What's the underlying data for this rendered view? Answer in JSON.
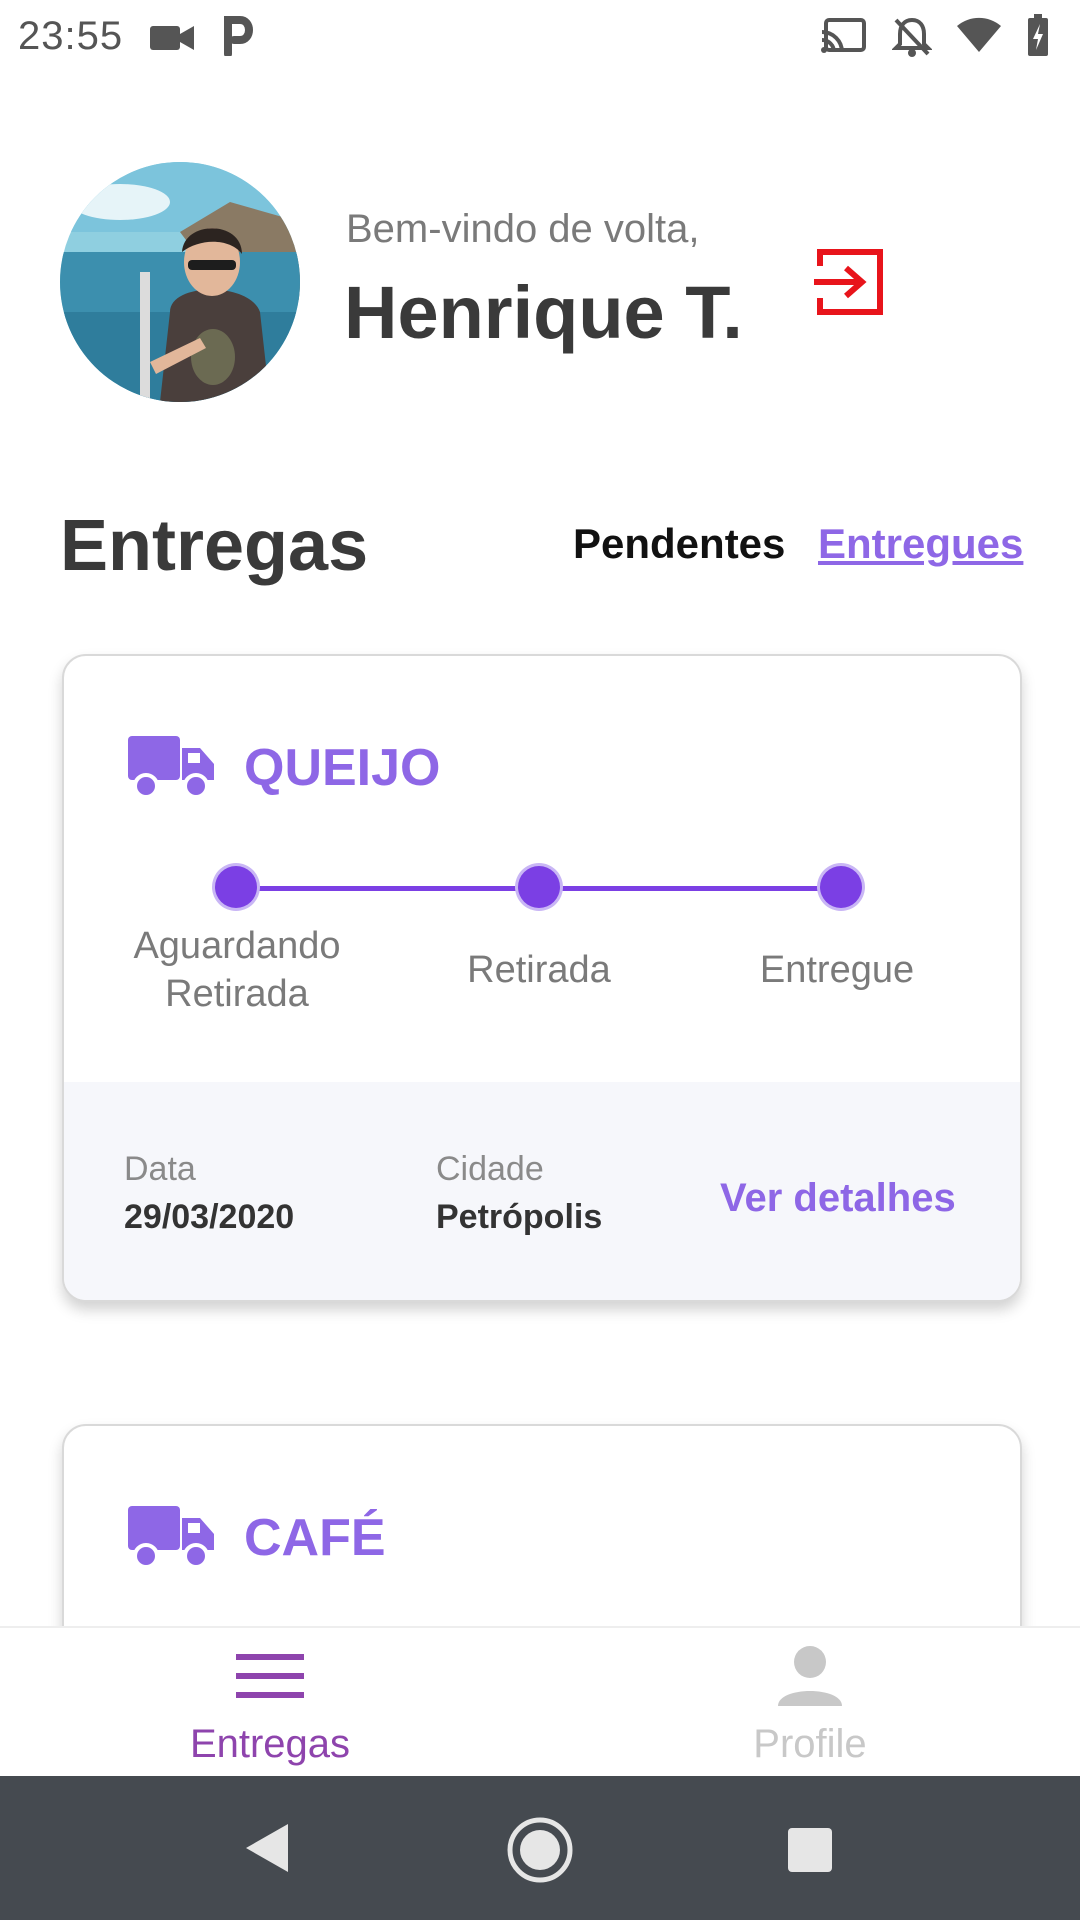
{
  "status_bar": {
    "time": "23:55",
    "icons": [
      "video-camera-icon",
      "parking-icon",
      "cast-icon",
      "notifications-off-icon",
      "wifi-icon",
      "battery-charging-icon"
    ]
  },
  "header": {
    "welcome_text": "Bem-vindo de volta,",
    "user_name": "Henrique T.",
    "logout_icon": "logout-icon",
    "logout_color": "#e8141b"
  },
  "deliveries": {
    "title": "Entregas",
    "tabs": [
      {
        "label": "Pendentes",
        "active": true
      },
      {
        "label": "Entregues",
        "active": false
      }
    ]
  },
  "cards": [
    {
      "product": "QUEIJO",
      "icon": "truck-icon",
      "steps": [
        "Aguardando\nRetirada",
        "Retirada",
        "Entregue"
      ],
      "date_label": "Data",
      "date_value": "29/03/2020",
      "city_label": "Cidade",
      "city_value": "Petrópolis",
      "details_label": "Ver detalhes"
    },
    {
      "product": "CAFÉ",
      "icon": "truck-icon"
    }
  ],
  "bottom_nav": {
    "tabs": [
      {
        "label": "Entregas",
        "icon": "menu-icon",
        "active": true
      },
      {
        "label": "Profile",
        "icon": "person-icon",
        "active": false
      }
    ]
  },
  "system_nav": [
    "back-icon",
    "home-icon",
    "recents-icon"
  ],
  "colors": {
    "accent": "#8e67e6",
    "progress": "#7b3fe4",
    "active_nav": "#8e44ad",
    "inactive_nav": "#c8c8c8"
  }
}
